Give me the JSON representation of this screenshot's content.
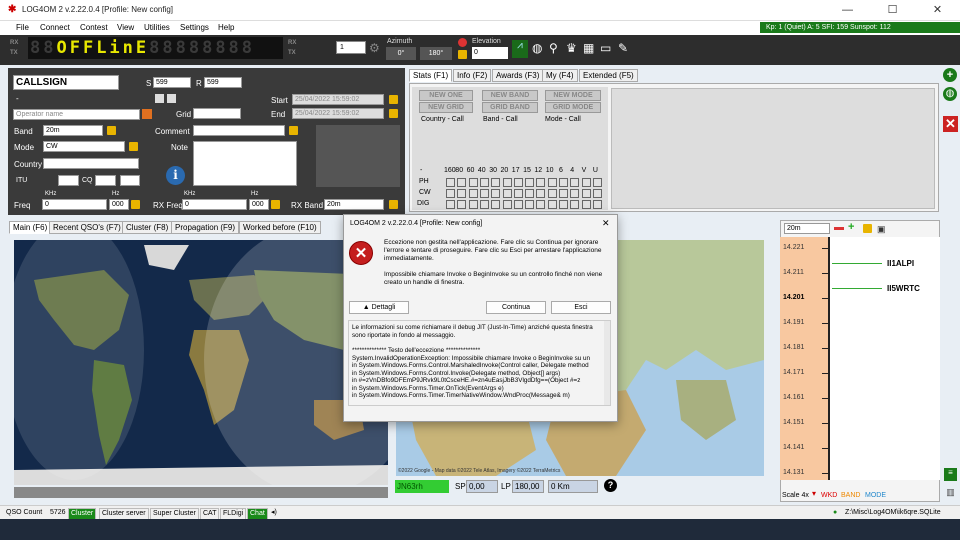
{
  "window": {
    "title": "LOG4OM 2 v.2.22.0.4 [Profile: New config]"
  },
  "menu": [
    "File",
    "Connect",
    "Contest",
    "View",
    "Utilities",
    "Settings",
    "Help"
  ],
  "kp_status": "Kp: 1 (Quiet)  A: 5  SFI: 159 Sunspot: 112",
  "toolbar": {
    "display_text": "OFFLinE",
    "rx": "RX",
    "tx": "TX",
    "spin_value": "1",
    "azimuth_label": "Azimuth",
    "az1": "0°",
    "az2": "180°",
    "elevation_label": "Elevation",
    "elevation_value": "0"
  },
  "qso": {
    "callsign": "CALLSIGN",
    "s_label": "S",
    "s_value": "599",
    "r_label": "R",
    "r_value": "599",
    "dash": "-",
    "operator_placeholder": "Operator name",
    "grid_label": "Grid",
    "start_label": "Start",
    "start_value": "25/04/2022 15:59:02",
    "end_label": "End",
    "end_value": "25/04/2022 15:59:02",
    "band_label": "Band",
    "band_value": "20m",
    "comment_label": "Comment",
    "mode_label": "Mode",
    "mode_value": "CW",
    "note_label": "Note",
    "country_label": "Country",
    "itu_label": "ITU",
    "cq_label": "CQ",
    "freq_label": "Freq",
    "khz": "KHz",
    "hz": "Hz",
    "freq_value": "0",
    "hz_value": "000",
    "rxfreq_label": "RX Freq",
    "rxfreq_value": "0",
    "rxhz_value": "000",
    "rxband_label": "RX Band",
    "rxband_value": "20m"
  },
  "stats": {
    "tabs": [
      "Stats (F1)",
      "Info (F2)",
      "Awards (F3)",
      "My (F4)",
      "Extended (F5)"
    ],
    "btn_new_one": "NEW ONE",
    "btn_new_grid": "NEW GRID",
    "btn_new_band": "NEW BAND",
    "btn_grid_band": "GRID BAND",
    "btn_new_mode": "NEW MODE",
    "btn_grid_mode": "GRID MODE",
    "country_call": "Country - Call",
    "band_call": "Band - Call",
    "mode_call": "Mode - Call",
    "dash": "-",
    "bands": [
      "160",
      "80",
      "60",
      "40",
      "30",
      "20",
      "17",
      "15",
      "12",
      "10",
      "6",
      "4",
      "V",
      "U"
    ],
    "rows": [
      "PH",
      "CW",
      "DIG"
    ]
  },
  "lower_tabs": [
    "Main (F6)",
    "Recent QSO's (F7)",
    "Cluster (F8)",
    "Propagation (F9)",
    "Worked before (F10)"
  ],
  "map": {
    "locator": "JN63rh",
    "sp_label": "SP",
    "sp_value": "0,00",
    "lp_label": "LP",
    "lp_value": "180,00",
    "km_value": "0 Km",
    "credits": "©2022 Google - Map data ©2022 Tele Atlas, Imagery ©2022 TerraMetrics"
  },
  "bandmap": {
    "band": "20m",
    "freqs": [
      "14.221",
      "14.211",
      "14.201",
      "14.191",
      "14.181",
      "14.171",
      "14.161",
      "14.151",
      "14.141",
      "14.131"
    ],
    "spots": [
      "II1ALPI",
      "II5WRTC"
    ],
    "scale": "Scale 4x",
    "wkd": "WKD",
    "band_lbl": "BAND",
    "mode_lbl": "MODE"
  },
  "dialog": {
    "title": "LOG4OM 2 v.2.22.0.4 [Profile: New config]",
    "msg1": "Eccezione non gestita nell'applicazione. Fare clic su Continua per ignorare l'errore e tentare di proseguire. Fare clic su Esci per arrestare l'applicazione immediatamente.",
    "msg2": "Impossibile chiamare Invoke o BeginInvoke su un controllo finché non viene creato un handle di finestra.",
    "details": "Dettagli",
    "continue": "Continua",
    "exit": "Esci",
    "info": "Le informazioni su come richiamare il debug JIT (Just-In-Time) anziché questa finestra sono riportate in fondo al messaggio.",
    "trace": [
      "************** Testo dell'eccezione **************",
      "System.InvalidOperationException: Impossibile chiamare Invoke o BeginInvoke su un",
      "   in System.Windows.Forms.Control.MarshaledInvoke(Control caller, Delegate method",
      "   in System.Windows.Forms.Control.Invoke(Delegate method, Object[] args)",
      "   in #=zVnDBfo9DFEmP9JRvk9L0tCsceHE.#=zn4uEasjJbB3VlgdDfg==(Object #=z",
      "   in System.Windows.Forms.Timer.OnTick(EventArgs e)",
      "   in System.Windows.Forms.Timer.TimerNativeWindow.WndProc(Message& m)"
    ]
  },
  "status": {
    "qso_count_label": "QSO Count",
    "qso_count": "5726",
    "cluster": "Cluster",
    "cluster_server": "Cluster server",
    "super_cluster": "Super Cluster",
    "cat": "CAT",
    "fldigi": "FLDigi",
    "chat": "Chat",
    "db_path": "Z:\\Misc\\Log4OM\\ik6qre.SQLite"
  }
}
